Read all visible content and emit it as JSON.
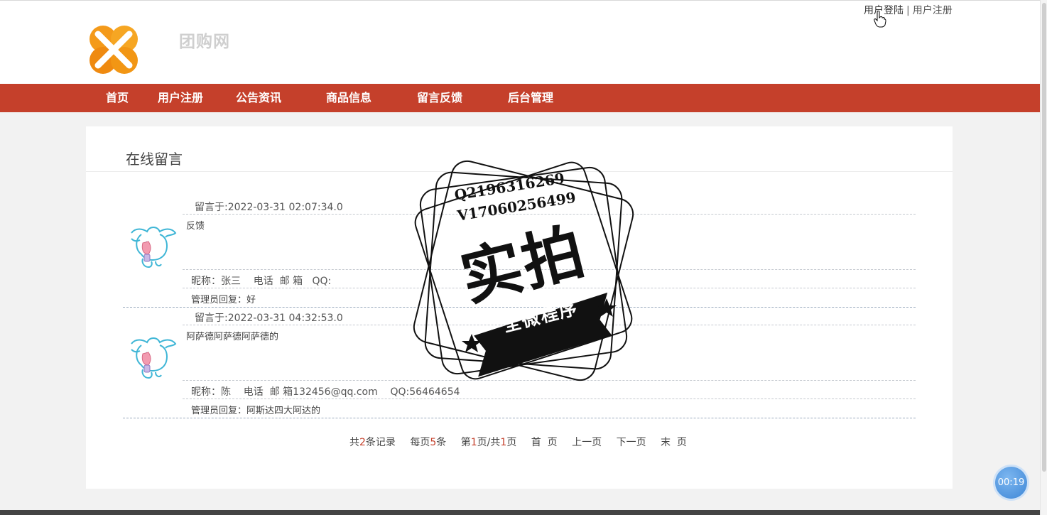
{
  "header": {
    "site_name": "团购网",
    "login_link": "用户登陆",
    "separator": "|",
    "register_link": "用户注册"
  },
  "nav": {
    "items": [
      "首页",
      "用户注册",
      "公告资讯",
      "商品信息",
      "留言反馈",
      "后台管理"
    ]
  },
  "panel": {
    "title": "在线留言"
  },
  "messages": [
    {
      "time": "留言于:2022-03-31 02:07:34.0",
      "content": "反馈",
      "info": "昵称：张三    电话  邮 箱   QQ:",
      "reply": "管理员回复：好"
    },
    {
      "time": "留言于:2022-03-31 04:32:53.0",
      "content": "阿萨德阿萨德阿萨德的",
      "info": "昵称：陈    电话  邮 箱132456@qq.com    QQ:56464654",
      "reply": "管理员回复：阿斯达四大阿达的"
    }
  ],
  "pager": {
    "total_prefix": "共",
    "total_count": "2",
    "total_suffix": "条记录",
    "per_prefix": "每页",
    "per_count": "5",
    "per_suffix": "条",
    "page_prefix": "第",
    "page_current": "1",
    "page_mid": "页/共",
    "page_total": "1",
    "page_suffix": "页",
    "first": "首  页",
    "prev": "上一页",
    "next": "下一页",
    "last": "末  页"
  },
  "watermark": {
    "line1": "Q2196316269",
    "line2": "V17060256499",
    "big": "实拍",
    "ribbon": "全微程序"
  },
  "timer": "00:19",
  "colors": {
    "nav_bg": "#c5402b",
    "logo_orange": "#f49a1a",
    "accent_red": "#c5402b"
  }
}
